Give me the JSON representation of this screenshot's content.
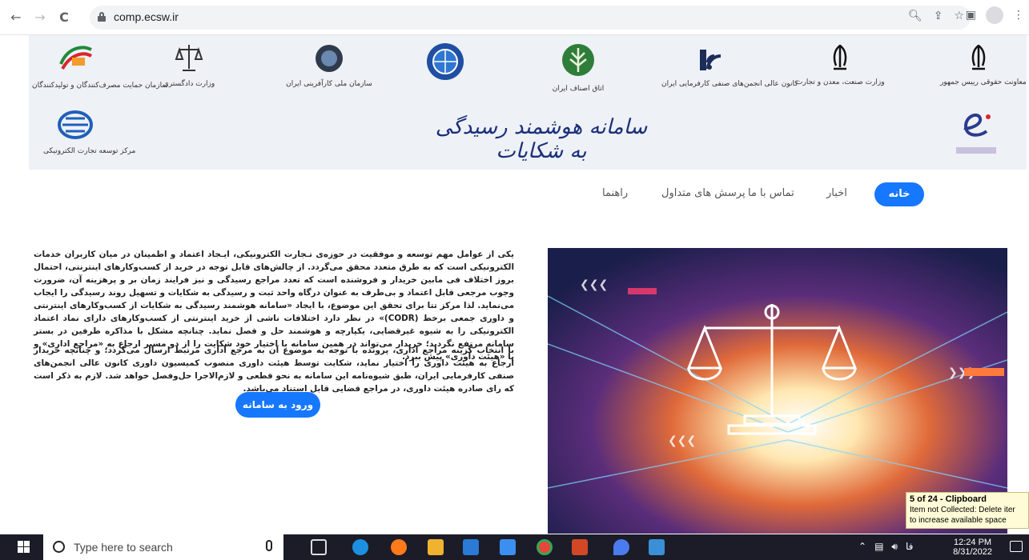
{
  "browser": {
    "url": "comp.ecsw.ir",
    "back_icon": "←",
    "forward_icon": "→",
    "reload_icon": "C"
  },
  "banner": {
    "title": "سامانه هوشمند رسیدگی به شکایات",
    "logos": [
      {
        "name": "president-legal-affairs",
        "caption": "معاونت حقوقی رییس جمهور"
      },
      {
        "name": "ministry-industry",
        "caption": "وزارت صنعت، معدن و تجارت"
      },
      {
        "name": "national-guilds-center",
        "caption": "کانون عالی انجمن‌های صنفی کارفرمایی ایران"
      },
      {
        "name": "guilds-chamber",
        "caption": "اتاق اصناف ایران"
      },
      {
        "name": "chamber-of-commerce",
        "caption": ""
      },
      {
        "name": "national-entrepreneurship",
        "caption": "سازمان ملی کارآفرینی ایران"
      },
      {
        "name": "justice-ministry",
        "caption": "وزارت دادگستری"
      },
      {
        "name": "consumer-protection",
        "caption": "سازمان حمایت مصرف‌کنندگان و تولیدکنندگان"
      },
      {
        "name": "e-namad",
        "caption": ""
      },
      {
        "name": "ecommerce-center",
        "caption": "مرکز توسعه تجارت الکترونیکی"
      }
    ]
  },
  "menu": {
    "home": "خانه",
    "news": "اخبار",
    "contact": "تماس با ما",
    "faq": "پرسش های متداول",
    "guide": "راهنما"
  },
  "content": {
    "paragraph1": "یکی از عوامل مهم توسعه و موفقیت در حوزه‌ی تـجارت الکترونیکی، ایـجاد اعتماد و اطمینان در میان کاربران خدمات الکترونیکی است که به طرق متعدد محقق می‌گردد. از چالش‌های قابل توجه در خرید از کسب‌وکارهای اینترنتی، احتمال بروز اختلاف فی مابین خریدار و فروشنده است که تعدد مراجع رسیدگی و نیز فرایند زمان بر و پرهزینه آن، ضرورت وجوب مرجعی قابل اعتماد و بی‌طرف به عنوان درگاه واحد ثبت و رسیدگی به شکایات و تسهیل روند رسیدگی را ایجاب می‌نماید. لذا مرکز تتا برای تحقق این موضوع، با ایجاد «سامانه هوشمند رسیدگی به شکایات از کسب‌وکارهای اینترنتی و داوری جمعی برخط (CODR)» در نظر دارد اختلافات ناشی از خرید اینترنتی از کسب‌وکارهای دارای نماد اعتماد الکترونیکی را به شیوه غیرقضایی، یکپارچه و هوشمند حل و فصل نماید. چنانچه مشکل با مذاکره طرفین در بستر سامانه مرتفع نگردید؛ خریدار می‌تواند در همین سامانه با اختیار خود شکایت را از دو مسیر ارجاع به «مراجع اداری» و یا «هیئت داوری» پیش ببرد.",
    "paragraph2": "با انتخاب گزینه مراجع اداری، پرونده با توجه به موضوع آن به مرجع اداری مرتبط ارسال می‌گردد؛ و چنانچه خریدار ارجاع به هیئت داوری را اختیار نماید، شکایت توسط هیئت داوری منصوب کمیسیون داوری کانون عالی انجمن‌های صنفی کارفرمایی ایران، طبق شیوه‌نامه این سامانه به نحو قطعی و لازم‌الاجرا حل‌وفصل خواهد شد. لازم به ذکر است که رای صادره هیئت داوری، در مراجع قضایی قابل استناد می‌باشد.",
    "enter_button": "ورود به سامانه"
  },
  "clipboard_toast": {
    "title": "5 of 24 - Clipboard",
    "line1": "Item not Collected: Delete iter",
    "line2": "to increase available space"
  },
  "taskbar": {
    "search_placeholder": "Type here to search",
    "time": "12:24 PM",
    "date": "8/31/2022",
    "lang": "فا"
  }
}
